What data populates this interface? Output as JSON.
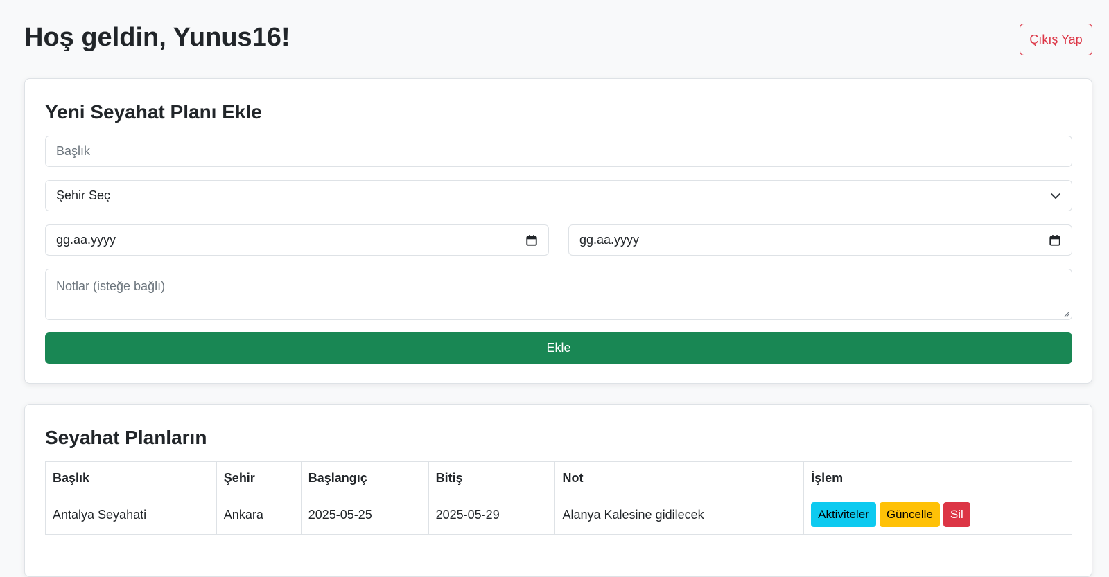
{
  "header": {
    "greeting": "Hoş geldin, Yunus16!",
    "logout_label": "Çıkış Yap"
  },
  "form": {
    "title": "Yeni Seyahat Planı Ekle",
    "title_placeholder": "Başlık",
    "city_select_value": "Şehir Seç",
    "start_date_placeholder": "gg.aa.yyyy",
    "end_date_placeholder": "gg.aa.yyyy",
    "notes_placeholder": "Notlar (isteğe bağlı)",
    "submit_label": "Ekle"
  },
  "plans": {
    "title": "Seyahat Planların",
    "columns": [
      "Başlık",
      "Şehir",
      "Başlangıç",
      "Bitiş",
      "Not",
      "İşlem"
    ],
    "rows": [
      {
        "title": "Antalya Seyahati",
        "city": "Ankara",
        "start": "2025-05-25",
        "end": "2025-05-29",
        "note": "Alanya Kalesine gidilecek",
        "actions": {
          "activities": "Aktiviteler",
          "update": "Güncelle",
          "delete": "Sil"
        }
      }
    ]
  },
  "colors": {
    "primary_success": "#198754",
    "danger": "#dc3545",
    "info": "#0dcaf0",
    "warning": "#ffc107",
    "background": "#f8f9fa"
  },
  "icons": {
    "calendar": "calendar-icon",
    "chevron": "chevron-down-icon",
    "resize": "resize-handle-icon"
  }
}
